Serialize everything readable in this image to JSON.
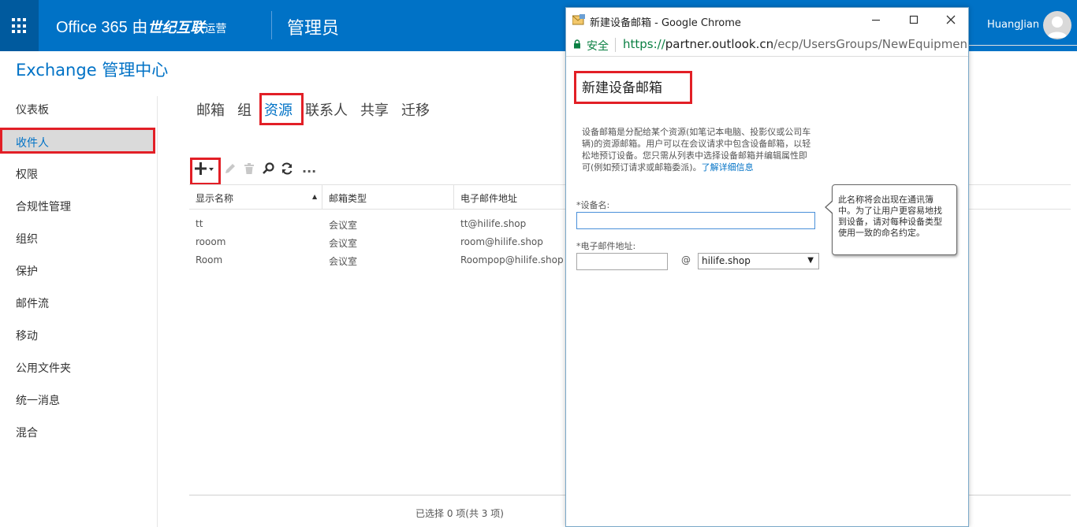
{
  "topbar": {
    "brand_main": "Office 365 由",
    "brand_company": "世纪互联",
    "brand_suffix": "运营",
    "role": "管理员",
    "username": "HuangJian"
  },
  "page": {
    "title": "Exchange 管理中心"
  },
  "nav": {
    "items": [
      {
        "label": "仪表板"
      },
      {
        "label": "收件人"
      },
      {
        "label": "权限"
      },
      {
        "label": "合规性管理"
      },
      {
        "label": "组织"
      },
      {
        "label": "保护"
      },
      {
        "label": "邮件流"
      },
      {
        "label": "移动"
      },
      {
        "label": "公用文件夹"
      },
      {
        "label": "统一消息"
      },
      {
        "label": "混合"
      }
    ],
    "selected": "收件人"
  },
  "tabs": [
    {
      "label": "邮箱"
    },
    {
      "label": "组"
    },
    {
      "label": "资源"
    },
    {
      "label": "联系人"
    },
    {
      "label": "共享"
    },
    {
      "label": "迁移"
    }
  ],
  "toolbar": {
    "icons": [
      "add-icon",
      "edit-icon",
      "delete-icon",
      "search-icon",
      "refresh-icon",
      "more-icon"
    ],
    "more_label": "..."
  },
  "grid": {
    "columns": [
      "显示名称",
      "邮箱类型",
      "电子邮件地址"
    ],
    "rows": [
      {
        "name": "tt",
        "type": "会议室",
        "email": "tt@hilife.shop"
      },
      {
        "name": "rooom",
        "type": "会议室",
        "email": "room@hilife.shop"
      },
      {
        "name": "Room",
        "type": "会议室",
        "email": "Roompop@hilife.shop"
      }
    ],
    "status": "已选择 0 项(共 3 项)"
  },
  "popup": {
    "window_title": "新建设备邮箱 - Google Chrome",
    "secure_label": "安全",
    "url_scheme": "https://",
    "url_host": "partner.outlook.cn",
    "url_path": "/ecp/UsersGroups/NewEquipmentMaill",
    "dialog_title": "新建设备邮箱",
    "description": "设备邮箱是分配给某个资源(如笔记本电脑、投影仪或公司车辆)的资源邮箱。用户可以在会议请求中包含设备邮箱，以轻松地预订设备。您只需从列表中选择设备邮箱并编辑属性即可(例如预订请求或邮箱委派)。",
    "learn_more": "了解详细信息",
    "device_name_label": "*设备名:",
    "device_name_value": "",
    "email_label": "*电子邮件地址:",
    "email_value": "",
    "at_sign": "@",
    "domain_selected": "hilife.shop",
    "tooltip": "此名称将会出现在通讯簿中。为了让用户更容易地找到设备，请对每种设备类型使用一致的命名约定。"
  },
  "colors": {
    "header_blue": "#0072c6",
    "highlight_red": "#e21f26",
    "secure_green": "#0b8043"
  }
}
